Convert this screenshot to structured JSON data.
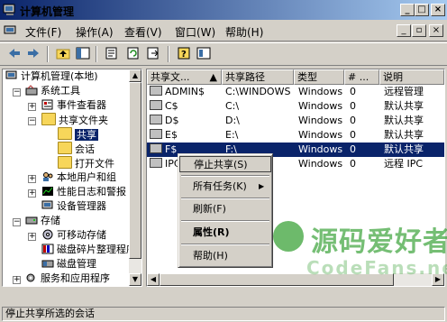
{
  "window": {
    "title": "计算机管理"
  },
  "menu": [
    "文件(F)",
    "操作(A)",
    "查看(V)",
    "窗口(W)",
    "帮助(H)"
  ],
  "tree": {
    "root": "计算机管理(本地)",
    "system_tools": "系统工具",
    "event_viewer": "事件查看器",
    "shared_folders": "共享文件夹",
    "shares": "共享",
    "sessions": "会话",
    "open_files": "打开文件",
    "local_users": "本地用户和组",
    "perf_logs": "性能日志和警报",
    "device_manager": "设备管理器",
    "storage": "存储",
    "removable": "可移动存储",
    "defrag": "磁盘碎片整理程序",
    "disk_mgmt": "磁盘管理",
    "services": "服务和应用程序"
  },
  "list": {
    "columns": [
      "共享文...",
      "共享路径",
      "类型",
      "# ...",
      "说明"
    ],
    "rows": [
      {
        "name": "ADMIN$",
        "path": "C:\\WINDOWS",
        "type": "Windows",
        "count": "0",
        "desc": "远程管理"
      },
      {
        "name": "C$",
        "path": "C:\\",
        "type": "Windows",
        "count": "0",
        "desc": "默认共享"
      },
      {
        "name": "D$",
        "path": "D:\\",
        "type": "Windows",
        "count": "0",
        "desc": "默认共享"
      },
      {
        "name": "E$",
        "path": "E:\\",
        "type": "Windows",
        "count": "0",
        "desc": "默认共享"
      },
      {
        "name": "F$",
        "path": "F:\\",
        "type": "Windows",
        "count": "0",
        "desc": "默认共享"
      },
      {
        "name": "IPC$",
        "path": "",
        "type": "Windows",
        "count": "0",
        "desc": "远程 IPC"
      }
    ],
    "selected_row": 4
  },
  "context_menu": {
    "stop_share": "停止共享(S)",
    "all_tasks": "所有任务(K)",
    "refresh": "刷新(F)",
    "properties": "属性(R)",
    "help": "帮助(H)"
  },
  "status": "停止共享所选的会话",
  "watermark": {
    "text": "源码爱好者",
    "sub": "CodeFans.net"
  },
  "colors": {
    "selection": "#0a246a",
    "title_start": "#0a246a",
    "title_end": "#a6caf0",
    "chrome": "#d4d0c8"
  }
}
